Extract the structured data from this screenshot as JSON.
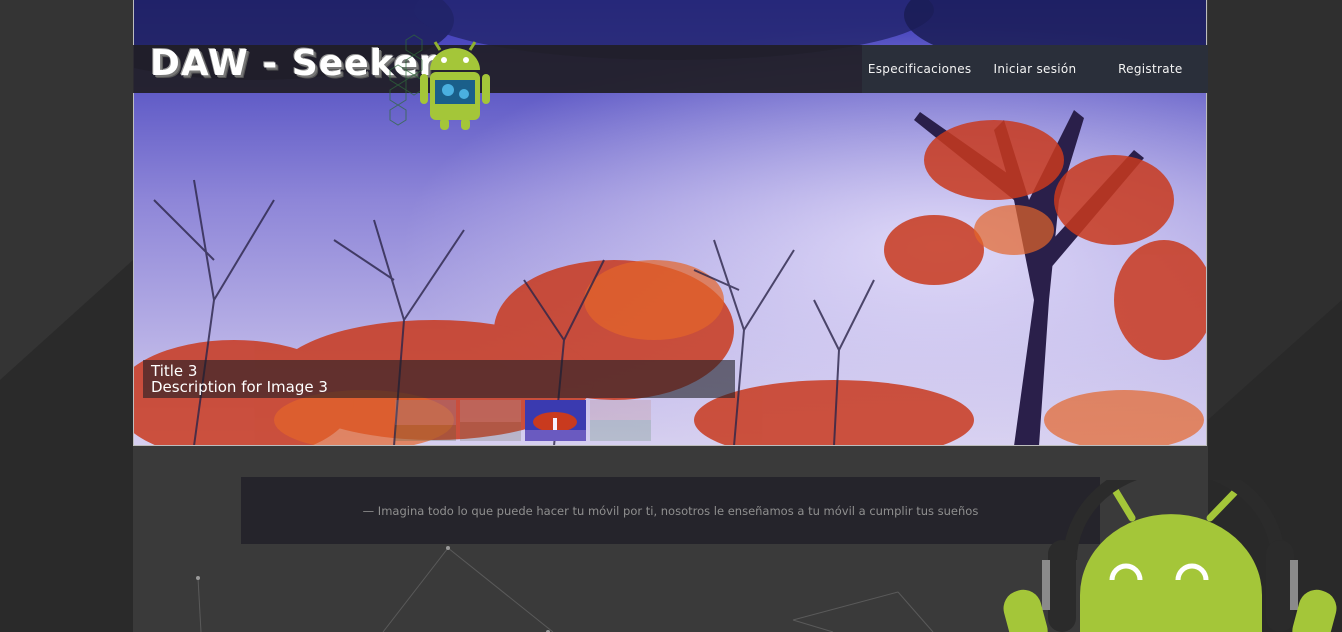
{
  "brand": {
    "logo_text": "DAW - Seeker"
  },
  "nav": {
    "items": [
      {
        "label": "Especificaciones"
      },
      {
        "label": "Iniciar sesión"
      },
      {
        "label": "Registrate"
      }
    ]
  },
  "slider": {
    "current_title": "Title 3",
    "current_description": "Description for Image 3",
    "thumbnails": [
      {
        "id": "image-1",
        "active": false
      },
      {
        "id": "image-2",
        "active": false
      },
      {
        "id": "image-3",
        "active": true
      },
      {
        "id": "image-4",
        "active": false
      }
    ]
  },
  "tagline": {
    "text": "— Imagina todo lo que puede hacer tu móvil por ti, nosotros le enseñamos a tu móvil a cumplir tus sueños"
  },
  "colors": {
    "android_green": "#a4c639",
    "header_bg": "#201e26",
    "nav_bg": "#2a2f3a"
  }
}
